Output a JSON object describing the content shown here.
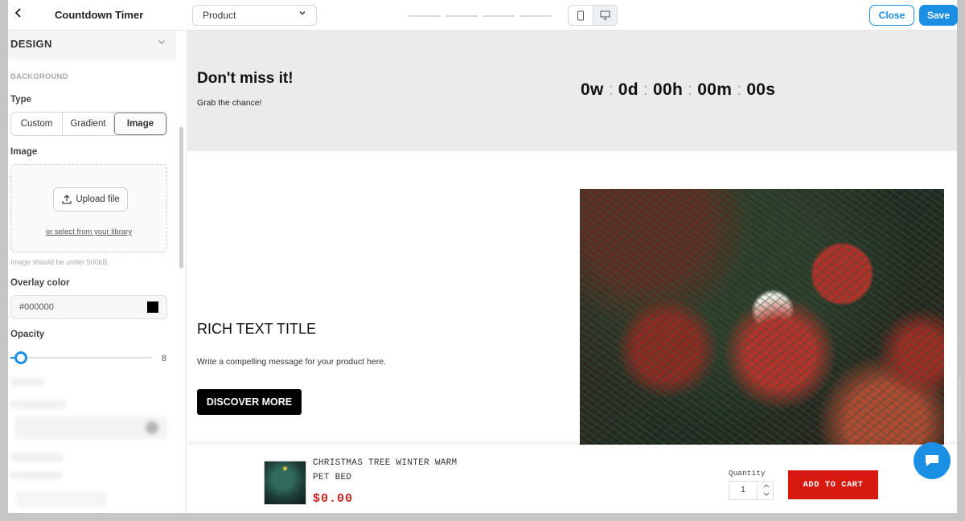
{
  "header": {
    "back_icon": "chevron-left-icon",
    "title": "Countdown Timer",
    "page_select": "Product",
    "devices": [
      "mobile-icon",
      "desktop-icon"
    ],
    "close_label": "Close",
    "save_label": "Save",
    "accent": "#1a8fe3"
  },
  "sidebar": {
    "section_title": "DESIGN",
    "group_label": "BACKGROUND",
    "type_label": "Type",
    "type_options": [
      "Custom",
      "Gradient",
      "Image"
    ],
    "type_selected": "Image",
    "image_label": "Image",
    "upload_label": "Upload file",
    "library_link": "or select from your library",
    "image_hint": "Image should be under 500kB.",
    "overlay_label": "Overlay color",
    "overlay_value": "#000000",
    "opacity_label": "Opacity",
    "opacity_value": "8"
  },
  "banner": {
    "heading": "Don't miss it!",
    "subtext": "Grab the chance!",
    "timer": {
      "weeks": "0w",
      "days": "0d",
      "hours": "00h",
      "minutes": "00m",
      "seconds": "00s",
      "separator": ":"
    }
  },
  "content": {
    "title": "RICH TEXT TITLE",
    "message": "Write a compelling message for your product here.",
    "button_label": "DISCOVER MORE"
  },
  "sticky_cart": {
    "product_name": "CHRISTMAS TREE WINTER WARM PET BED",
    "price": "$0.00",
    "quantity_label": "Quantity",
    "quantity_value": "1",
    "add_to_cart": "ADD TO CART",
    "price_color": "#c8211d",
    "button_color": "#d8190f"
  }
}
